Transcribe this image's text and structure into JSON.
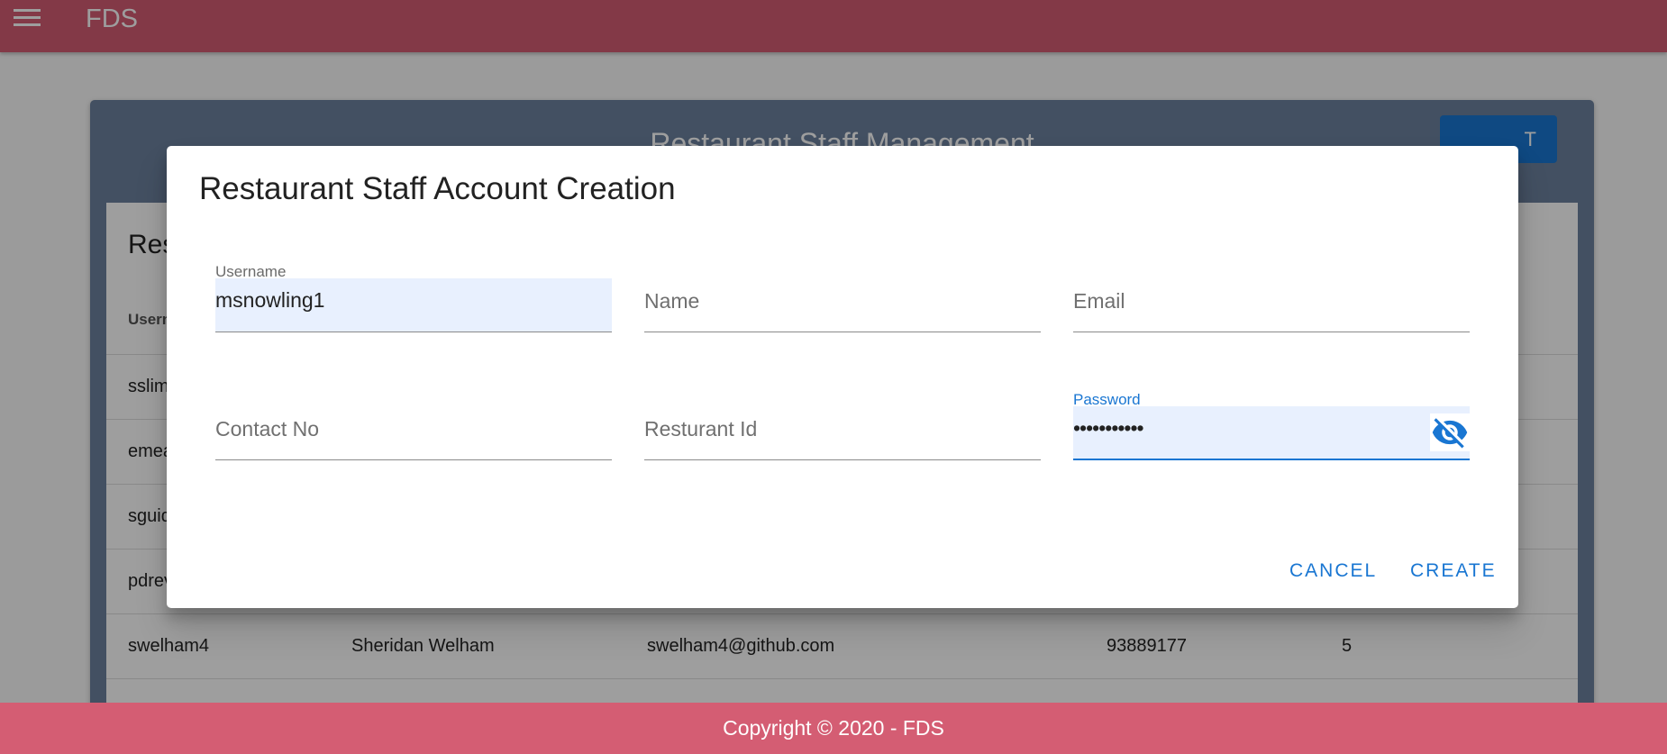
{
  "appbar": {
    "brand": "FDS"
  },
  "panel": {
    "title": "Restaurant Staff Management",
    "card_title": "Res",
    "add_button_label": "T",
    "column_header": "Usern",
    "rows": [
      {
        "username": "sslim"
      },
      {
        "username": "emea"
      },
      {
        "username": "sguid"
      },
      {
        "username": "pdrev"
      },
      {
        "username": "swelham4",
        "name": "Sheridan Welham",
        "email": "swelham4@github.com",
        "contact": "93889177",
        "restaurant_id": "5"
      }
    ]
  },
  "dialog": {
    "title": "Restaurant Staff Account Creation",
    "fields": {
      "username": {
        "label": "Username",
        "value": "msnowling1"
      },
      "name": {
        "placeholder": "Name"
      },
      "email": {
        "placeholder": "Email"
      },
      "contact": {
        "placeholder": "Contact No"
      },
      "restaurant_id": {
        "placeholder": "Resturant Id"
      },
      "password": {
        "label": "Password",
        "value": "•••••••••••"
      }
    },
    "cancel_label": "CANCEL",
    "create_label": "CREATE"
  },
  "footer": {
    "text": "Copyright © 2020 - FDS"
  },
  "colors": {
    "appbar": "#d45d73",
    "panel": "#6c829e",
    "accent": "#1976d2",
    "autofill": "#e8f0fe"
  },
  "icons": {
    "menu": "menu-icon",
    "visibility_off": "eye-off-icon"
  }
}
